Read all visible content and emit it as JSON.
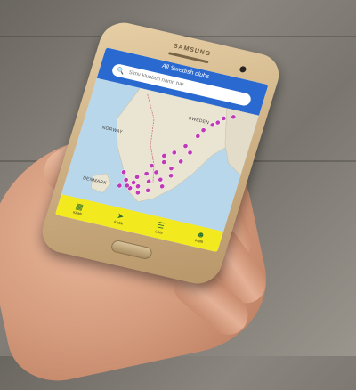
{
  "device": {
    "brand": "SAMSUNG"
  },
  "app": {
    "title": "All Swedish clubs",
    "search": {
      "placeholder": "Skriv klubben namn här"
    }
  },
  "map": {
    "labels": {
      "norway": "NORWAY",
      "sweden": "SWEDEN",
      "denmark": "DENMARK"
    },
    "marker_color": "#c03ab8"
  },
  "bottom_nav": {
    "items": [
      {
        "label": "Klubb",
        "icon": "clubs-icon"
      },
      {
        "label": "Klubb",
        "icon": "navigate-icon"
      },
      {
        "label": "Lista",
        "icon": "list-icon"
      },
      {
        "label": "Profil",
        "icon": "profile-icon"
      }
    ]
  },
  "colors": {
    "appbar": "#2a6ad0",
    "bottombar": "#f3e91f"
  }
}
